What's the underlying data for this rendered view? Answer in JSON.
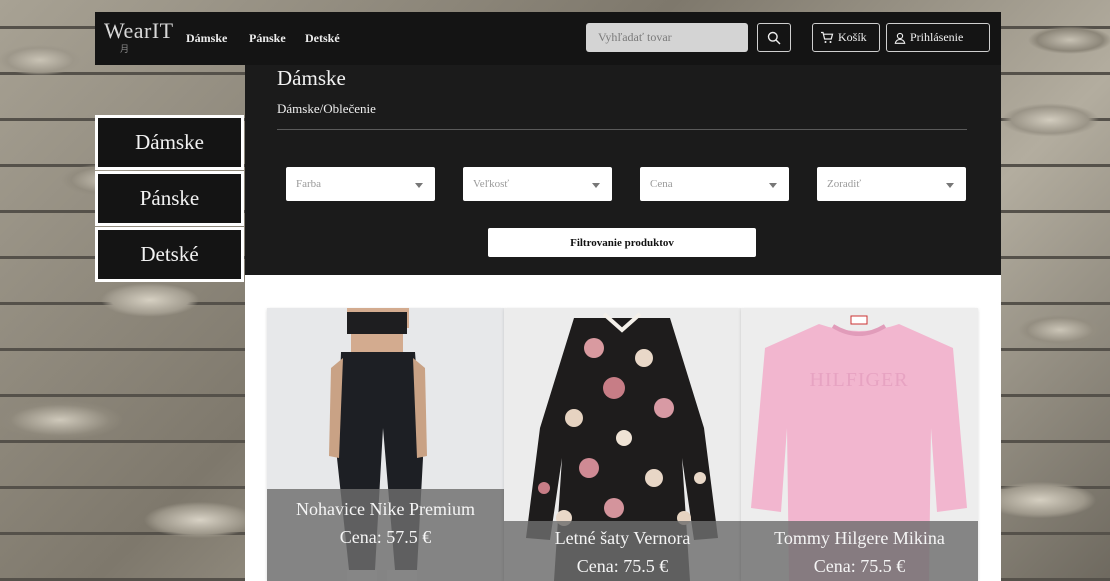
{
  "header": {
    "logo": "WearIT",
    "logo_sub": "月",
    "nav": [
      "Dámske",
      "Pánske",
      "Detské"
    ],
    "search_placeholder": "Vyhľadať tovar",
    "cart_label": "Košík",
    "login_label": "Prihlásenie"
  },
  "page": {
    "title": "Dámske",
    "breadcrumb": "Dámske/Oblečenie"
  },
  "filters": {
    "selects": [
      "Farba",
      "Veľkosť",
      "Cena",
      "Zoradiť"
    ],
    "button_label": "Filtrovanie produktov"
  },
  "sidebar": {
    "items": [
      "Dámske",
      "Pánske",
      "Detské"
    ]
  },
  "products": [
    {
      "name": "Nohavice Nike Premium",
      "price": "Cena: 57.5 €"
    },
    {
      "name": "Letné šaty Vernora",
      "price": "Cena: 75.5 €"
    },
    {
      "name": "Tommy Hilgere Mikina",
      "price": "Cena: 75.5 €"
    }
  ],
  "colors": {
    "dark": "#141414",
    "panel": "#1b1b1b",
    "sweater_pink": "#f2b6cf"
  },
  "icons": [
    "search-icon",
    "cart-icon",
    "user-icon",
    "chevron-down-icon"
  ]
}
